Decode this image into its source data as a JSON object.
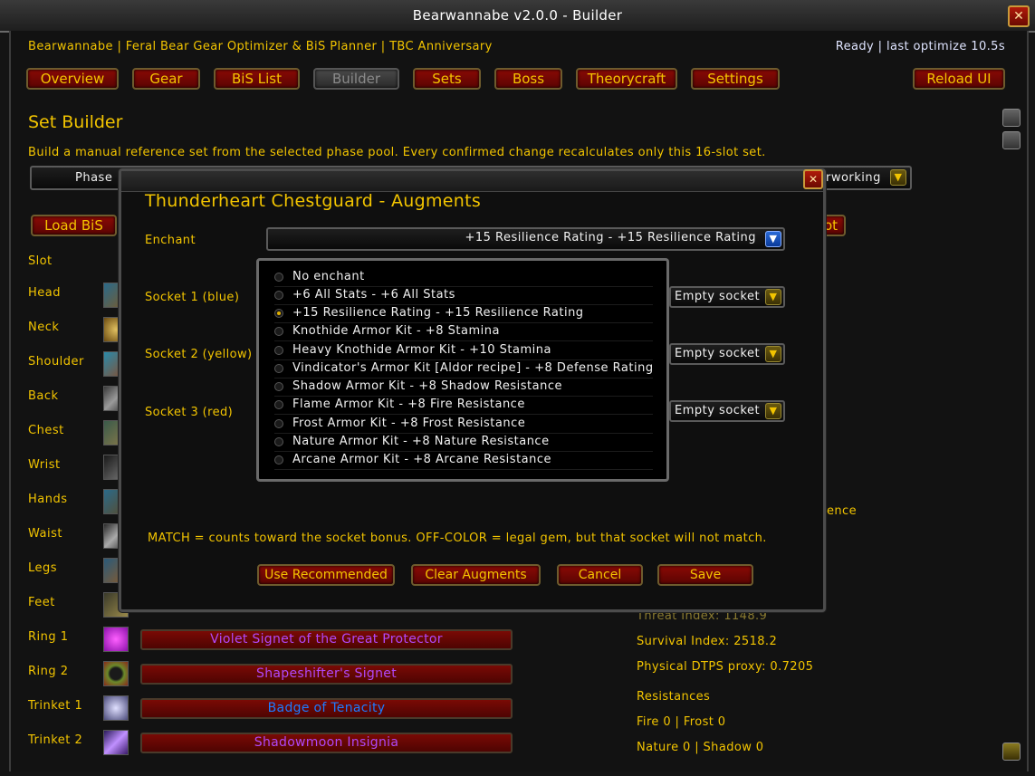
{
  "window": {
    "title": "Bearwannabe v2.0.0  -  Builder",
    "close_glyph": "✕"
  },
  "header": {
    "subtitle": "Bearwannabe | Feral Bear Gear Optimizer & BiS Planner | TBC Anniversary",
    "status": "Ready | last optimize 10.5s"
  },
  "tabs": [
    {
      "label": "Overview"
    },
    {
      "label": "Gear"
    },
    {
      "label": "BiS List"
    },
    {
      "label": "Builder"
    },
    {
      "label": "Sets"
    },
    {
      "label": "Boss"
    },
    {
      "label": "Theorycraft"
    },
    {
      "label": "Settings"
    }
  ],
  "reload_label": "Reload UI",
  "builder": {
    "title": "Set Builder",
    "description": "Build a manual reference set from the selected phase pool. Every confirmed change recalculates only this 16-slot set.",
    "phase_label": "Phase",
    "right_dropdown_value": "rworking",
    "load_bis_label": "Load BiS",
    "right_button_fragment": "ot",
    "slot_header": "Slot"
  },
  "slots": [
    {
      "label": "Head",
      "item": ""
    },
    {
      "label": "Neck",
      "item": ""
    },
    {
      "label": "Shoulder",
      "item": ""
    },
    {
      "label": "Back",
      "item": ""
    },
    {
      "label": "Chest",
      "item": ""
    },
    {
      "label": "Wrist",
      "item": ""
    },
    {
      "label": "Hands",
      "item": ""
    },
    {
      "label": "Waist",
      "item": ""
    },
    {
      "label": "Legs",
      "item": ""
    },
    {
      "label": "Feet",
      "item": ""
    },
    {
      "label": "Ring 1",
      "item": "Violet Signet of the Great Protector"
    },
    {
      "label": "Ring 2",
      "item": "Shapeshifter's Signet"
    },
    {
      "label": "Trinket 1",
      "item": "Badge of Tenacity"
    },
    {
      "label": "Trinket 2",
      "item": "Shadowmoon Insignia"
    }
  ],
  "colors": {
    "epic": "#b048f8",
    "rare": "#1e7bff",
    "gold": "#f2c400",
    "button_red": "#7a0a05"
  },
  "stats": {
    "fragment": "ence",
    "threat": "Threat Index: 1148.9",
    "survival": "Survival Index: 2518.2",
    "dtps": "Physical DTPS proxy: 0.7205",
    "resistances_header": "Resistances",
    "res_line1": "Fire 0 | Frost 0",
    "res_line2": "Nature 0 | Shadow 0"
  },
  "modal": {
    "title": "Thunderheart Chestguard - Augments",
    "enchant_label": "Enchant",
    "enchant_value": "+15 Resilience Rating - +15 Resilience Rating",
    "sockets": [
      {
        "label": "Socket 1 (blue)",
        "value": "Empty socket"
      },
      {
        "label": "Socket 2 (yellow)",
        "value": "Empty socket"
      },
      {
        "label": "Socket 3 (red)",
        "value": "Empty socket"
      }
    ],
    "options": [
      {
        "label": "No enchant",
        "selected": false
      },
      {
        "label": "+6 All Stats - +6 All Stats",
        "selected": false
      },
      {
        "label": "+15 Resilience Rating - +15 Resilience Rating",
        "selected": true
      },
      {
        "label": "Knothide Armor Kit - +8 Stamina",
        "selected": false
      },
      {
        "label": "Heavy Knothide Armor Kit - +10 Stamina",
        "selected": false
      },
      {
        "label": "Vindicator's Armor Kit [Aldor recipe] - +8 Defense Rating",
        "selected": false
      },
      {
        "label": "Shadow Armor Kit - +8 Shadow Resistance",
        "selected": false
      },
      {
        "label": "Flame Armor Kit - +8 Fire Resistance",
        "selected": false
      },
      {
        "label": "Frost Armor Kit - +8 Frost Resistance",
        "selected": false
      },
      {
        "label": "Nature Armor Kit - +8 Nature Resistance",
        "selected": false
      },
      {
        "label": "Arcane Armor Kit - +8 Arcane Resistance",
        "selected": false
      }
    ],
    "hint": "MATCH = counts toward the socket bonus. OFF-COLOR = legal gem, but that socket will not match.",
    "buttons": {
      "recommended": "Use Recommended",
      "clear": "Clear Augments",
      "cancel": "Cancel",
      "save": "Save"
    }
  }
}
